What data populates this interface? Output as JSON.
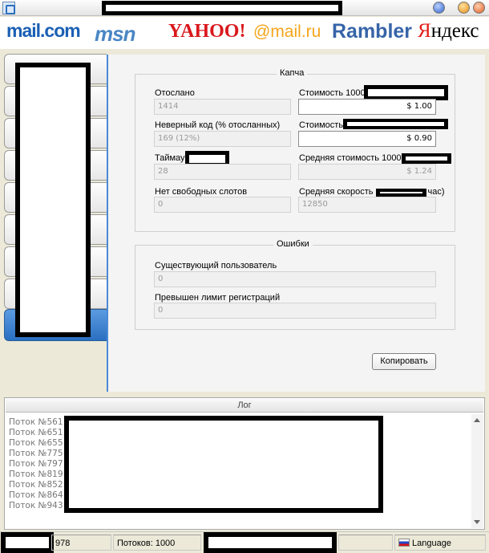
{
  "logos": {
    "mail": "mail.com",
    "msn": "msn",
    "yahoo": "YAHOO!",
    "mailru": "@mail.ru",
    "rambler": "Rambler",
    "yandex_first": "Я",
    "yandex_rest": "ндекс"
  },
  "captcha": {
    "legend": "Капча",
    "sent_label": "Отослано",
    "sent_value": "1414",
    "wrong_code_label": "Неверный код (% отосланных)",
    "wrong_code_value": "169 (12%)",
    "timeout_label": "Таймау",
    "timeout_value": "28",
    "no_slots_label": "Нет свободных слотов",
    "no_slots_value": "0",
    "cost1000_label": "Стоимость 1000",
    "cost1000_value": "$ 1.00",
    "cost_label": "Стоимость",
    "cost_value": "$ 0.90",
    "avg_cost_label": "Средняя стоимость 1000",
    "avg_cost_value": "$ 1.24",
    "avg_speed_label": "Средняя скорость",
    "avg_speed_suffix": "час)",
    "avg_speed_value": "12850"
  },
  "errors": {
    "legend": "Ошибки",
    "existing_user_label": "Существующий пользователь",
    "existing_user_value": "0",
    "reg_limit_label": "Превышен лимит регистраций",
    "reg_limit_value": "0"
  },
  "copy_button": "Копировать",
  "log": {
    "header": "Лог",
    "lines": [
      "Поток №561",
      "Поток №651",
      "Поток №655",
      "Поток №775",
      "Поток №797",
      "Поток №819",
      "Поток №852",
      "Поток №864",
      "Поток №943"
    ]
  },
  "status": {
    "count": "978",
    "threads": "Потоков: 1000",
    "language": "Language"
  }
}
